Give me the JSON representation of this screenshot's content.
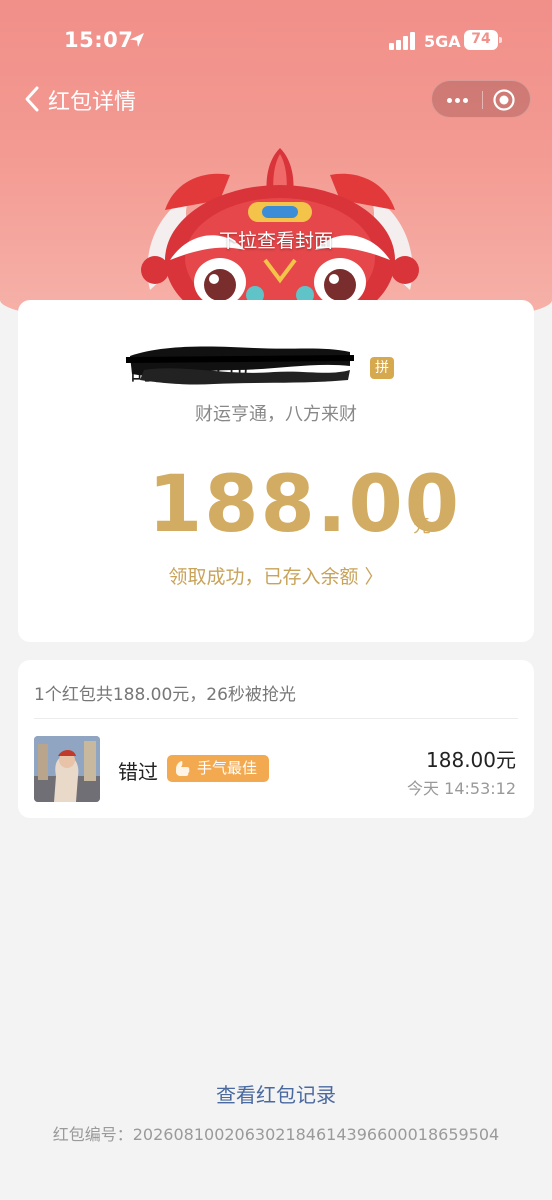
{
  "status_bar": {
    "time": "15:07",
    "network": "5GA",
    "battery": "74"
  },
  "nav": {
    "title": "红包详情"
  },
  "cover": {
    "hint": "下拉查看封面"
  },
  "packet": {
    "sender_title": "的拜年红包",
    "pin_badge": "拼",
    "greeting": "财运亨通，八方来财",
    "amount": "188.00",
    "currency": "元",
    "received_link": "领取成功，已存入余额 〉"
  },
  "record": {
    "summary": "1个红包共188.00元，26秒被抢光",
    "receiver_name": "错过",
    "lucky_badge": "手气最佳",
    "amount": "188.00元",
    "time": "今天 14:53:12"
  },
  "footer": {
    "view_records": "查看红包记录",
    "packet_id": "红包编号：20260810020630218461439660001865950​4"
  },
  "colors": {
    "hero_red": "#f18f89",
    "gold": "#d1ac62",
    "badge_orange": "#f2a94f",
    "link_blue": "#4a6a9f"
  }
}
